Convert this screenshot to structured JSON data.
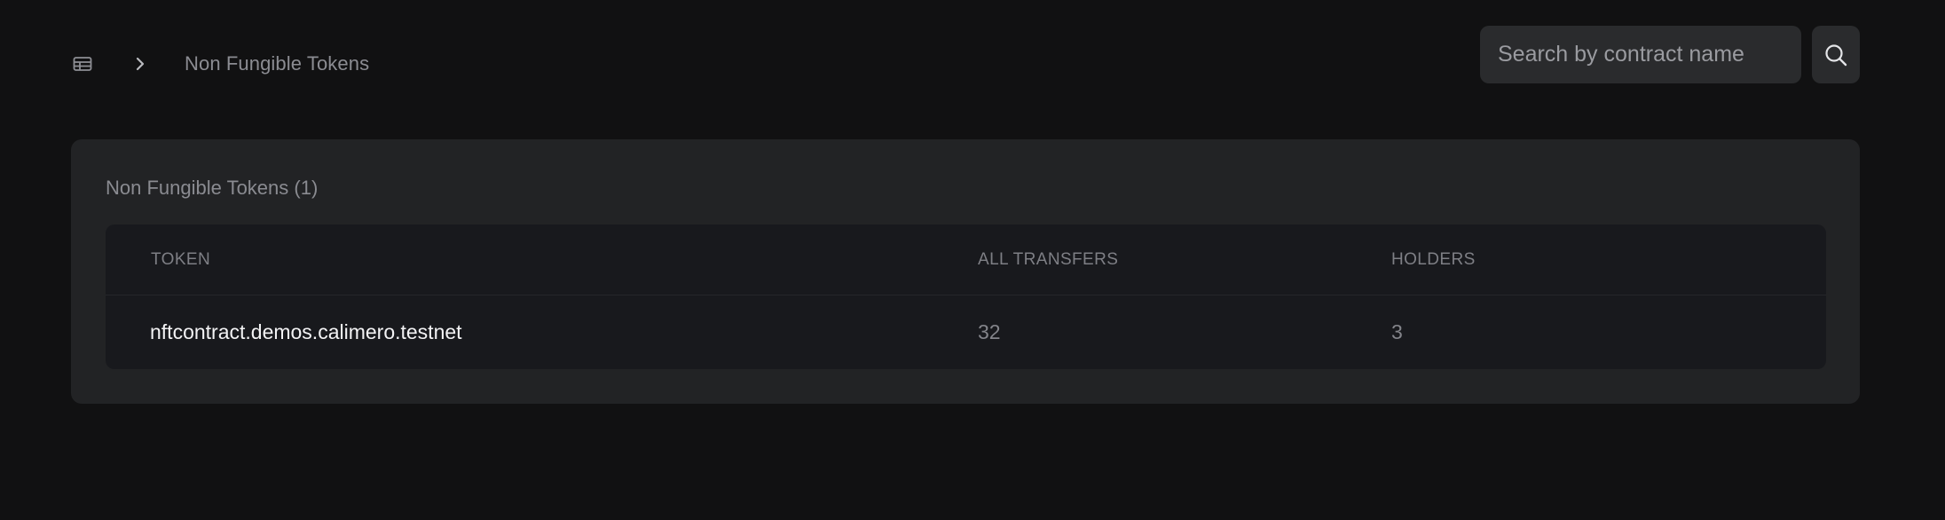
{
  "header": {
    "breadcrumb": {
      "home_icon": "table-icon",
      "separator_icon": "chevron-right-icon",
      "current": "Non Fungible Tokens"
    },
    "search": {
      "placeholder": "Search by contract name",
      "value": "",
      "button_icon": "search-icon"
    }
  },
  "main": {
    "card_title": "Non Fungible Tokens (1)",
    "table": {
      "columns": [
        "TOKEN",
        "ALL TRANSFERS",
        "HOLDERS"
      ],
      "rows": [
        {
          "token": "nftcontract.demos.calimero.testnet",
          "all_transfers": "32",
          "holders": "3"
        }
      ]
    }
  },
  "colors": {
    "background": "#111112",
    "card": "#222325",
    "table": "#18191d",
    "input": "#2a2b2d",
    "text_primary": "#f3f3f5",
    "text_muted": "#8a8b91"
  }
}
